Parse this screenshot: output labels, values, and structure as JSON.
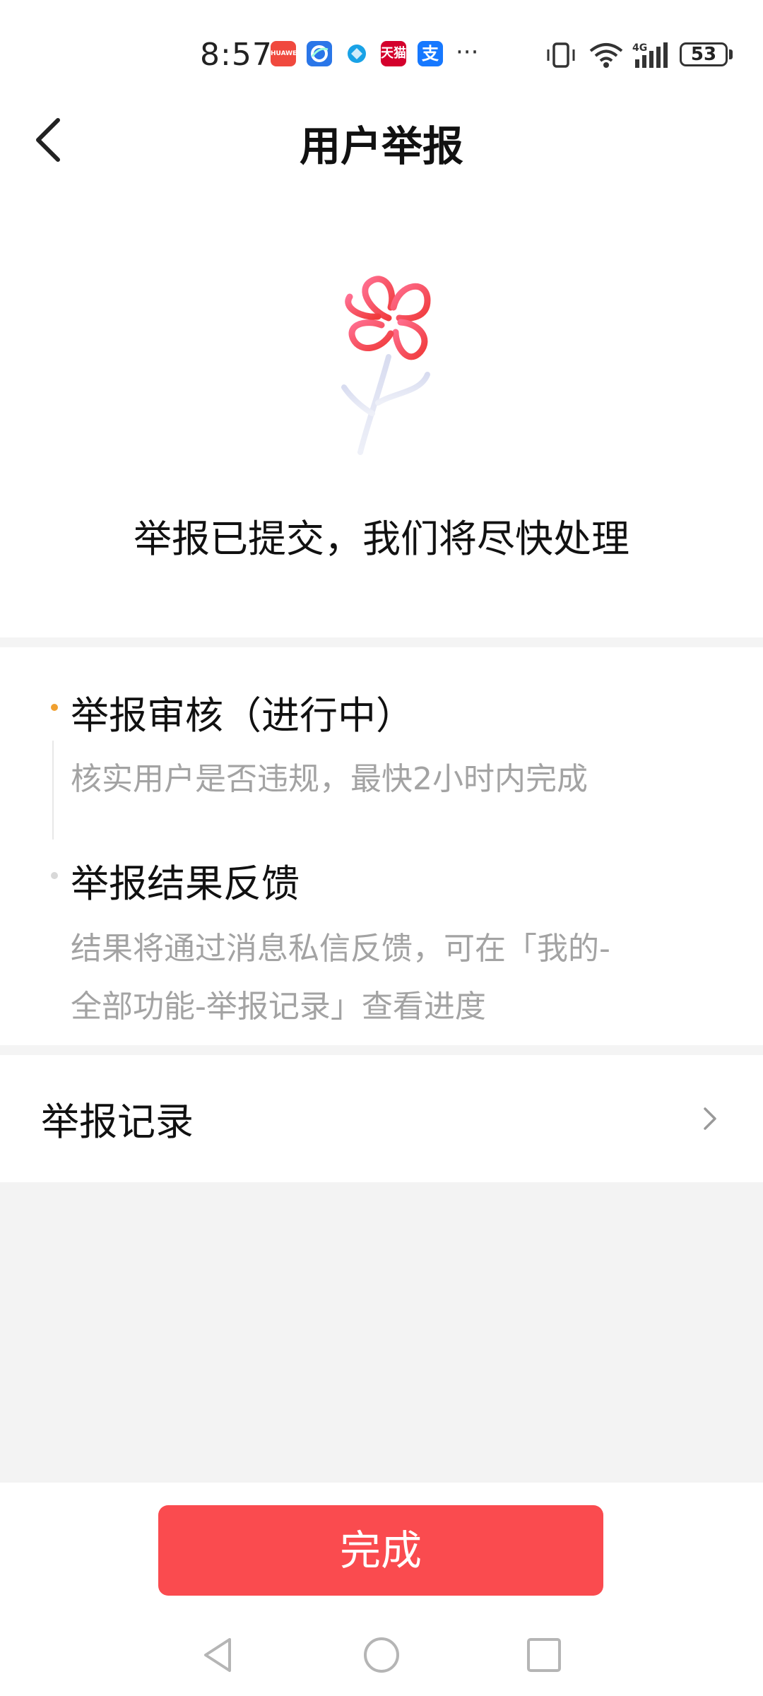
{
  "status_bar": {
    "time": "8:57",
    "apps": [
      {
        "icon": "huawei-appgallery-icon",
        "color": "#f0493e",
        "label": "HUAWEI"
      },
      {
        "icon": "browser-icon",
        "color": "#2a76e8",
        "label": ""
      },
      {
        "icon": "app-icon",
        "color": "#19a2e6",
        "label": ""
      },
      {
        "icon": "tmall-icon",
        "color": "#d4002c",
        "label": "天猫"
      },
      {
        "icon": "alipay-icon",
        "color": "#1678ff",
        "label": "支"
      }
    ],
    "more": "···",
    "battery": "53",
    "network": "4G"
  },
  "header": {
    "title": "用户举报"
  },
  "result": {
    "message": "举报已提交，我们将尽快处理"
  },
  "steps": [
    {
      "title": "举报审核（进行中）",
      "desc": "核实用户是否违规，最快2小时内完成",
      "active": true
    },
    {
      "title": "举报结果反馈",
      "desc_line1": "结果将通过消息私信反馈，可在「我的-",
      "desc_line2": "全部功能-举报记录」查看进度",
      "active": false
    }
  ],
  "record": {
    "label": "举报记录"
  },
  "actions": {
    "done_label": "完成"
  },
  "colors": {
    "accent": "#fa4b4f",
    "active_dot": "#f0a030",
    "inactive_dot": "#d8d8d8"
  }
}
